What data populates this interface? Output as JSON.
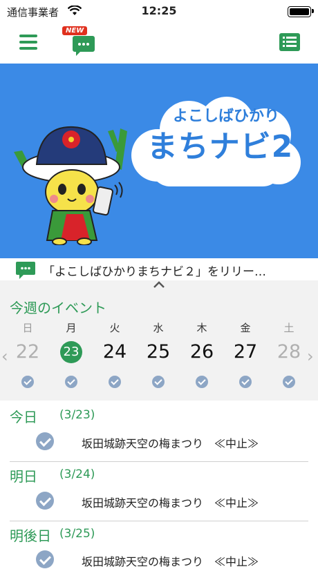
{
  "status_bar": {
    "carrier": "通信事業者",
    "time": "12:25"
  },
  "nav": {
    "new_badge": "NEW",
    "icons": [
      "hamburger-menu-icon",
      "chat-icon",
      "list-icon"
    ]
  },
  "banner": {
    "line1": "よこしばひかり",
    "line2": "まちナビ2",
    "bg_color": "#3b8ae6"
  },
  "notice": {
    "text": "「よこしばひかりまちナビ２」をリリー…"
  },
  "week": {
    "title": "今週のイベント",
    "days": [
      {
        "dow": "日",
        "date": "22"
      },
      {
        "dow": "月",
        "date": "23"
      },
      {
        "dow": "火",
        "date": "24"
      },
      {
        "dow": "水",
        "date": "25"
      },
      {
        "dow": "木",
        "date": "26"
      },
      {
        "dow": "金",
        "date": "27"
      },
      {
        "dow": "土",
        "date": "28"
      }
    ]
  },
  "events": [
    {
      "label": "今日",
      "date": "(3/23)",
      "title": "坂田城跡天空の梅まつり　≪中止≫"
    },
    {
      "label": "明日",
      "date": "(3/24)",
      "title": "坂田城跡天空の梅まつり　≪中止≫"
    },
    {
      "label": "明後日",
      "date": "(3/25)",
      "title": "坂田城跡天空の梅まつり　≪中止≫"
    }
  ],
  "colors": {
    "accent": "#2e9a57",
    "check": "#8da6c5"
  }
}
